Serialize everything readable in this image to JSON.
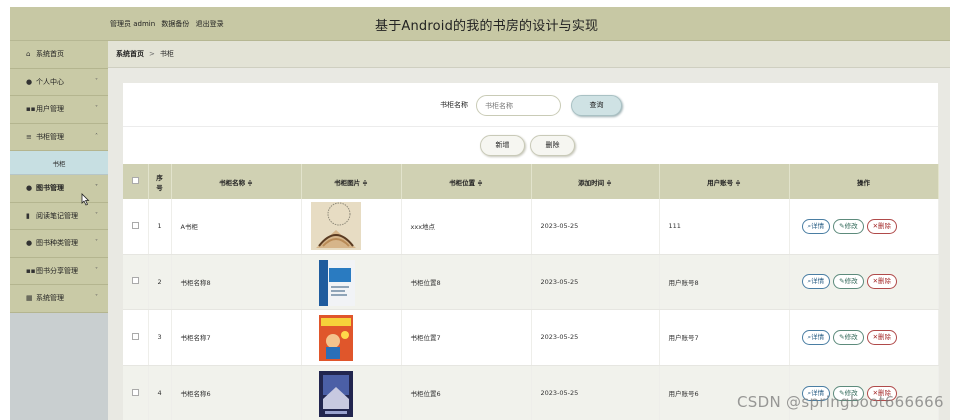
{
  "header": {
    "admin_label": "管理员 admin",
    "backup_label": "数据备份",
    "logout_label": "退出登录",
    "title": "基于Android的我的书房的设计与实现"
  },
  "sidebar": {
    "items": [
      {
        "label": "系统首页",
        "icon": "home-icon",
        "chev": ""
      },
      {
        "label": "个人中心",
        "icon": "user-icon",
        "chev": "˅"
      },
      {
        "label": "用户管理",
        "icon": "grid-icon",
        "chev": "˅"
      },
      {
        "label": "书柜管理",
        "icon": "list-icon",
        "chev": "˄"
      },
      {
        "label": "图书管理",
        "icon": "user-icon",
        "chev": "˅"
      },
      {
        "label": "阅读笔记管理",
        "icon": "bar-chart-icon",
        "chev": "˅"
      },
      {
        "label": "图书种类管理",
        "icon": "user-icon",
        "chev": "˅"
      },
      {
        "label": "图书分享管理",
        "icon": "grid-icon",
        "chev": "˅"
      },
      {
        "label": "系统管理",
        "icon": "table-icon",
        "chev": "˅"
      }
    ],
    "subitem": "书柜"
  },
  "breadcrumb": {
    "home": "系统首页",
    "sep": ">",
    "current": "书柜"
  },
  "search": {
    "label": "书柜名称",
    "placeholder": "书柜名称",
    "button": "查询"
  },
  "actions": {
    "add": "新增",
    "delete": "删除"
  },
  "table": {
    "headers": [
      "",
      "序号",
      "书柜名称 ≑",
      "书柜图片 ≑",
      "书柜位置 ≑",
      "添加时间 ≑",
      "用户账号 ≑",
      "操作"
    ],
    "seq_header_line1": "序",
    "seq_header_line2": "号",
    "rows": [
      {
        "seq": "1",
        "name": "A书柜",
        "location": "xxx地点",
        "date": "2023-05-25",
        "account": "111"
      },
      {
        "seq": "2",
        "name": "书柜名称8",
        "location": "书柜位置8",
        "date": "2023-05-25",
        "account": "用户账号8"
      },
      {
        "seq": "3",
        "name": "书柜名称7",
        "location": "书柜位置7",
        "date": "2023-05-25",
        "account": "用户账号7"
      },
      {
        "seq": "4",
        "name": "书柜名称6",
        "location": "书柜位置6",
        "date": "2023-05-25",
        "account": "用户账号6"
      }
    ],
    "ops": {
      "detail": "详情",
      "edit": "修改",
      "delete": "删除"
    }
  },
  "watermark": "CSDN @springboot666666",
  "colors": {
    "topbar": "#c7c8a4",
    "sidebar": "#c9caa6",
    "table_header": "#d0d1b3",
    "accent": "#cfe2e4"
  }
}
